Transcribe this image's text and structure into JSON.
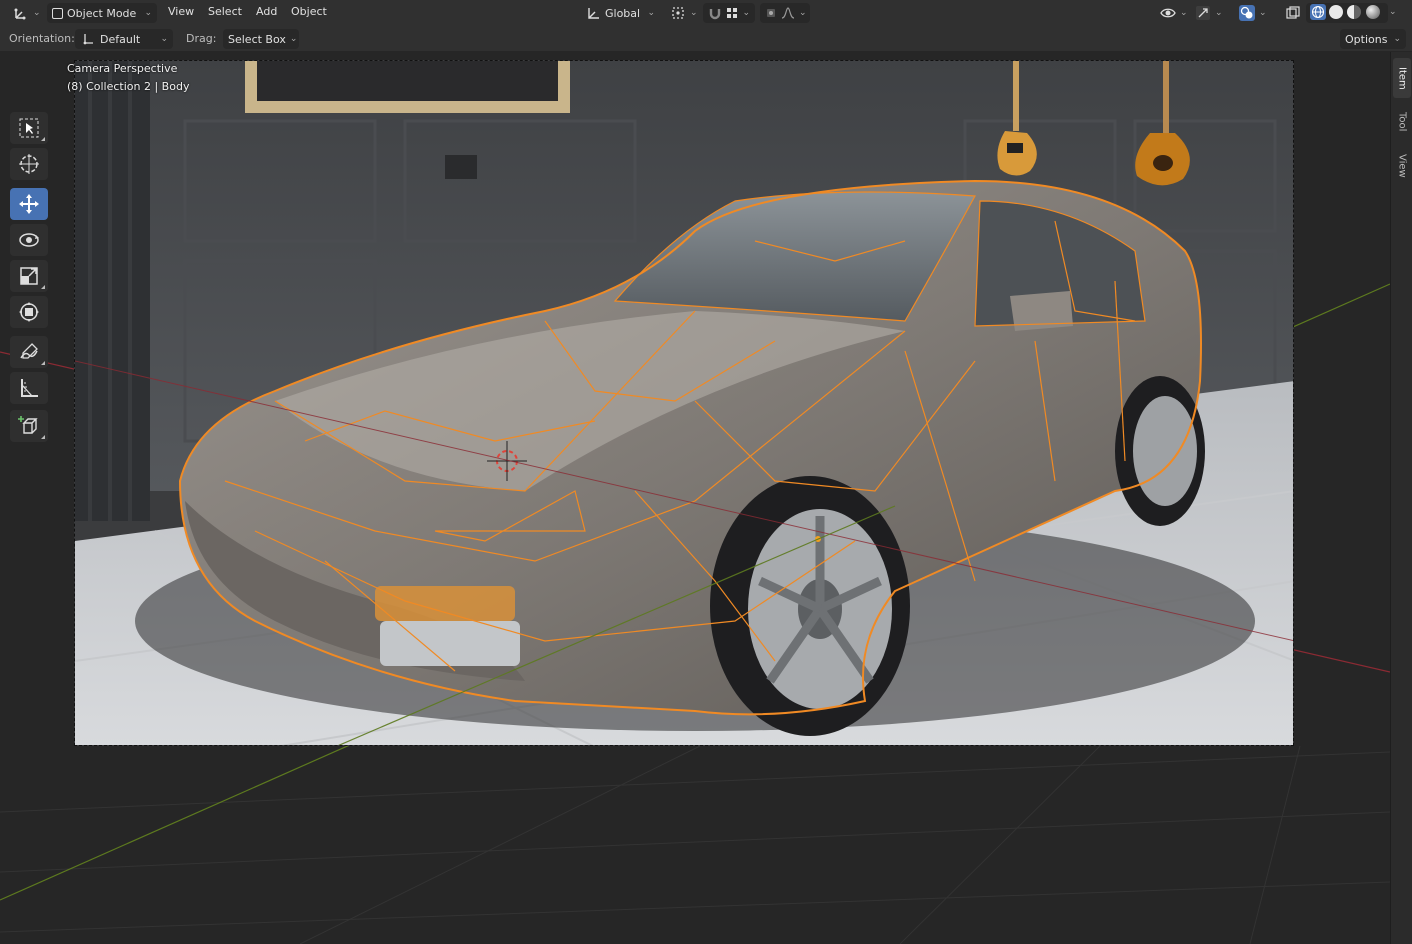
{
  "header": {
    "mode_label": "Object Mode",
    "menus": [
      "View",
      "Select",
      "Add",
      "Object"
    ],
    "transform_space": "Global"
  },
  "toolbar": {
    "orientation_label": "Orientation:",
    "orientation_value": "Default",
    "drag_label": "Drag:",
    "drag_value": "Select Box",
    "options_label": "Options"
  },
  "viewport": {
    "view_name": "Camera Perspective",
    "collection_info": "(8) Collection 2 | Body"
  },
  "sidebar_tabs": [
    "Item",
    "Tool",
    "View"
  ],
  "tools": [
    {
      "name": "select-box-icon"
    },
    {
      "name": "cursor-icon"
    },
    {
      "name": "move-icon",
      "active": true
    },
    {
      "name": "rotate-icon"
    },
    {
      "name": "scale-icon"
    },
    {
      "name": "transform-icon"
    },
    {
      "name": "annotate-icon"
    },
    {
      "name": "measure-icon"
    },
    {
      "name": "add-cube-icon"
    }
  ],
  "colors": {
    "accent": "#4772b3",
    "selection_outline": "#f08a24",
    "x_axis": "#8b2a33",
    "y_axis": "#5d7a1f"
  }
}
